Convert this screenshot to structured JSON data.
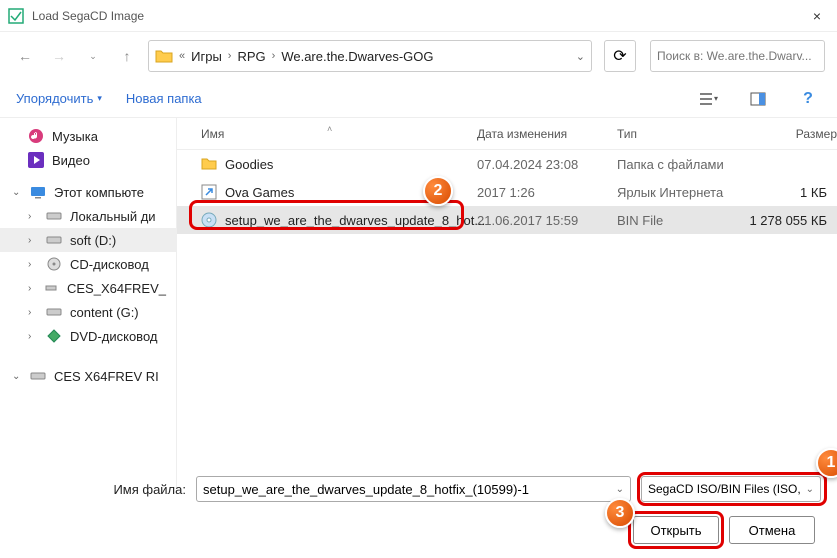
{
  "window": {
    "title": "Load SegaCD Image",
    "close_x": "×"
  },
  "nav": {
    "back": "←",
    "forward": "→",
    "up": "↑",
    "breadcrumb": {
      "root_chev": "«",
      "parts": [
        "Игры",
        "RPG",
        "We.are.the.Dwarves-GOG"
      ],
      "sep": "›"
    },
    "refresh": "⟳",
    "search_placeholder": "Поиск в: We.are.the.Dwarv..."
  },
  "toolbar": {
    "organize": "Упорядочить",
    "organize_arrow": "▾",
    "new_folder": "Новая папка",
    "view_icon": "≡",
    "preview_icon": "▫",
    "help_icon": "?"
  },
  "sidebar": {
    "items": [
      {
        "icon": "music",
        "label": "Музыка",
        "color": "#d83b7c"
      },
      {
        "icon": "video",
        "label": "Видео",
        "color": "#6b2fbf"
      }
    ],
    "computer_label": "Этот компьюте",
    "drives": [
      {
        "label": "Локальный ди"
      },
      {
        "label": "soft (D:)",
        "selected": true
      },
      {
        "label": "CD-дисковод"
      },
      {
        "label": "CES_X64FREV_"
      },
      {
        "label": "content (G:)"
      },
      {
        "label": "DVD-дисковод"
      },
      {
        "label": "CES X64FREV RI"
      }
    ]
  },
  "columns": {
    "name": "Имя",
    "date": "Дата изменения",
    "type": "Тип",
    "size": "Размер",
    "sort_indicator": "˄"
  },
  "files": [
    {
      "icon": "folder",
      "name": "Goodies",
      "date": "07.04.2024 23:08",
      "type": "Папка с файлами",
      "size": ""
    },
    {
      "icon": "shortcut",
      "name": "Ova Games",
      "date": "2017 1:26",
      "type": "Ярлык Интернета",
      "size": "1 КБ"
    },
    {
      "icon": "disc",
      "name": "setup_we_are_the_dwarves_update_8_hot...",
      "date": "21.06.2017 15:59",
      "type": "BIN File",
      "size": "1 278 055 КБ",
      "selected": true
    }
  ],
  "footer": {
    "filename_label": "Имя файла:",
    "filename_value": "setup_we_are_the_dwarves_update_8_hotfix_(10599)-1",
    "filter_value": "SegaCD ISO/BIN Files (ISO,BIN)",
    "open_btn": "Открыть",
    "cancel_btn": "Отмена",
    "dd": "⌄"
  },
  "annotations": {
    "n1": "1",
    "n2": "2",
    "n3": "3"
  }
}
